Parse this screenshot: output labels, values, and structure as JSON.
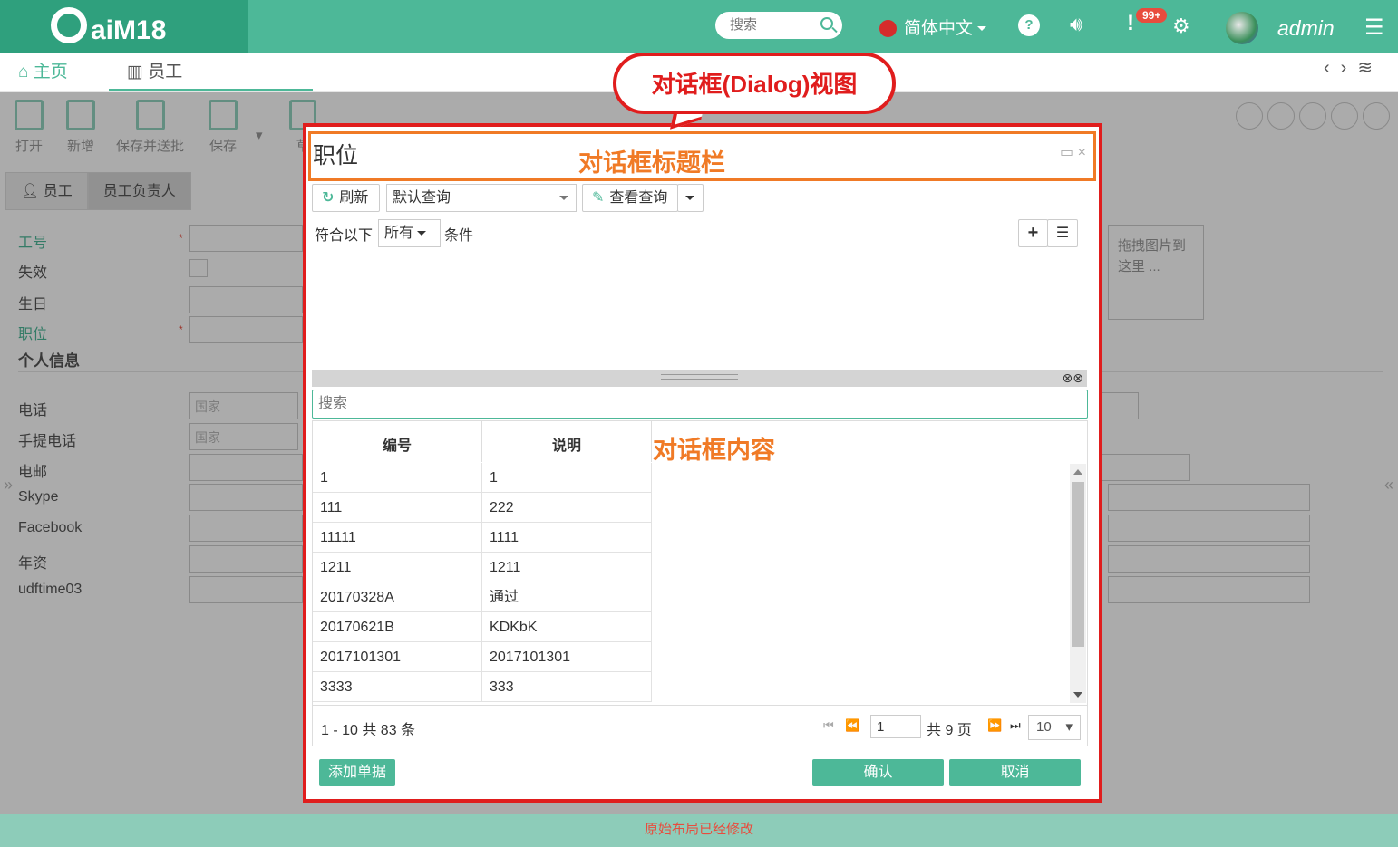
{
  "app": {
    "logo": "aiM18"
  },
  "topbar": {
    "search_placeholder": "搜索",
    "language": "简体中文",
    "notification_badge": "99+",
    "username": "admin"
  },
  "tabs": [
    {
      "label": "主页"
    },
    {
      "label": "员工"
    }
  ],
  "toolbar": {
    "items": [
      {
        "label": "打开"
      },
      {
        "label": "新增"
      },
      {
        "label": "保存并送批"
      },
      {
        "label": "保存"
      },
      {
        "label": "草"
      }
    ]
  },
  "subtabs": [
    {
      "label": "员工"
    },
    {
      "label": "员工负责人"
    }
  ],
  "form": {
    "fields": [
      {
        "label": "工号"
      },
      {
        "label": "失效"
      },
      {
        "label": "生日"
      },
      {
        "label": "职位"
      }
    ],
    "section_title": "个人信息",
    "contact_fields": [
      {
        "label": "电话",
        "placeholder": "国家"
      },
      {
        "label": "手提电话",
        "placeholder": "国家"
      },
      {
        "label": "电邮"
      },
      {
        "label": "Skype"
      },
      {
        "label": "Facebook"
      },
      {
        "label": "年资"
      },
      {
        "label": "udftime03"
      }
    ],
    "drop_zone": "拖拽图片到这里 ..."
  },
  "annotations": {
    "bubble": "对话框(Dialog)视图",
    "title_bar": "对话框标题栏",
    "content": "对话框内容"
  },
  "dialog": {
    "title": "职位",
    "refresh_label": "刷新",
    "query_select": "默认查询",
    "view_query_label": "查看查询",
    "condition_prefix": "符合以下",
    "condition_mode": "所有",
    "condition_suffix": "条件",
    "search_placeholder": "搜索",
    "grid": {
      "columns": [
        "编号",
        "说明"
      ],
      "rows": [
        [
          "1",
          "1"
        ],
        [
          "111",
          "222"
        ],
        [
          "11111",
          "1111"
        ],
        [
          "1211",
          "1211"
        ],
        [
          "20170328A",
          "通过"
        ],
        [
          "20170621B",
          "KDKbK"
        ],
        [
          "2017101301",
          "2017101301"
        ],
        [
          "3333",
          "333"
        ]
      ]
    },
    "pager": {
      "info": "1 - 10 共 83 条",
      "current_page": "1",
      "total_pages": "共 9 页",
      "page_size": "10"
    },
    "add_button": "添加单据",
    "confirm_button": "确认",
    "cancel_button": "取消"
  },
  "footer": {
    "message": "原始布局已经修改"
  }
}
